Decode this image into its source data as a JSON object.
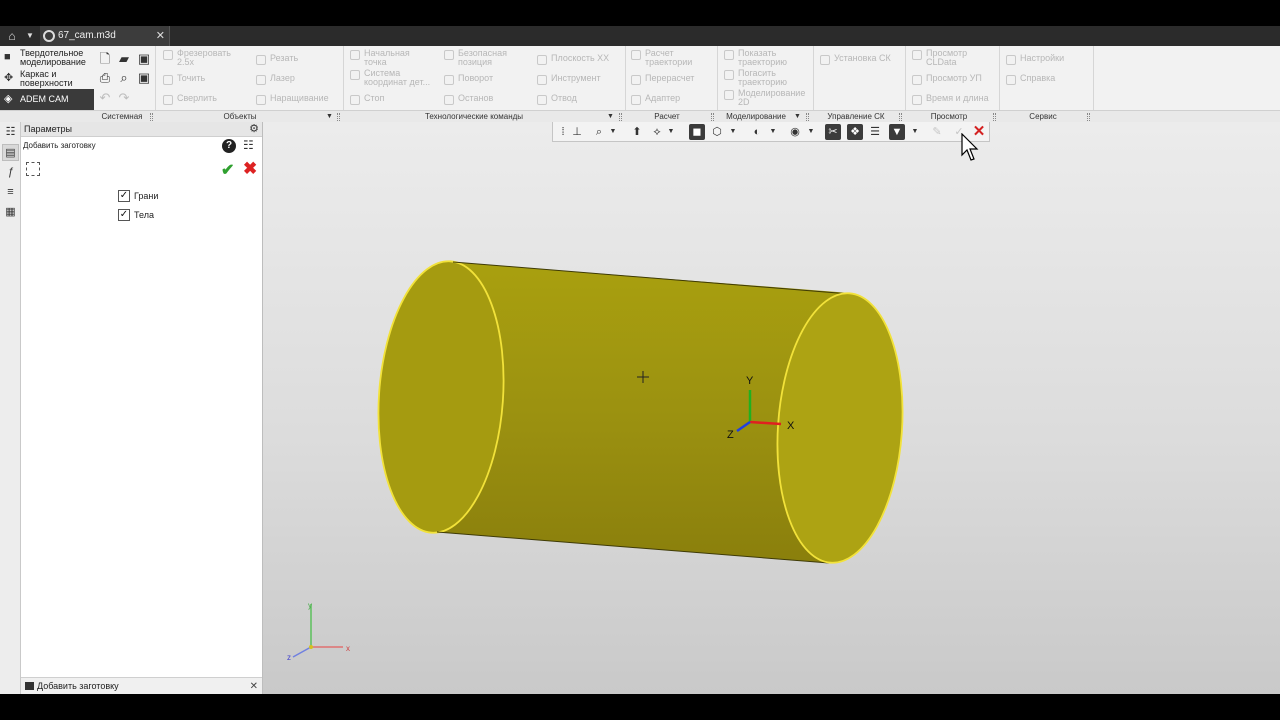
{
  "tabbar": {
    "doc_tab_label": "67_cam.m3d",
    "home_icon": "home-icon",
    "close_glyph": "✕"
  },
  "ribbon": {
    "modes": [
      {
        "label_line1": "Твердотельное",
        "label_line2": "моделирование",
        "icon": "solid-icon"
      },
      {
        "label_line1": "Каркас и",
        "label_line2": "поверхности",
        "icon": "wireframe-icon"
      },
      {
        "label_line1": "ADEM CAM",
        "label_line2": "",
        "icon": "cam-icon",
        "active": true
      }
    ],
    "objects": {
      "mill25_l1": "Фрезеровать",
      "mill25_l2": "2.5x",
      "turn": "Точить",
      "drill": "Сверлить",
      "cut": "Резать",
      "laser": "Лазер",
      "deposit": "Наращивание"
    },
    "tech": {
      "start_point_l1": "Начальная",
      "start_point_l2": "точка",
      "cs_l1": "Система",
      "cs_l2": "координат дет...",
      "stop": "Стоп",
      "safe_l1": "Безопасная",
      "safe_l2": "позиция",
      "rotate": "Поворот",
      "halt": "Останов",
      "plane": "Плоскость XX",
      "tool": "Инструмент",
      "retract": "Отвод"
    },
    "calc": {
      "traj_l1": "Расчет",
      "traj_l2": "траектории",
      "recalc": "Перерасчет",
      "adapter": "Адаптер"
    },
    "modeling": {
      "show_l1": "Показать",
      "show_l2": "траекторию",
      "hide_l1": "Погасить",
      "hide_l2": "траекторию",
      "model2d_l1": "Моделирование",
      "model2d_l2": "2D"
    },
    "csmgmt": {
      "install": "Установка СК"
    },
    "view": {
      "cldata_l1": "Просмотр",
      "cldata_l2": "CLData",
      "up": "Просмотр УП",
      "time": "Время и длина"
    },
    "service": {
      "settings": "Настройки",
      "help": "Справка"
    },
    "group_labels": {
      "system": "Системная",
      "objects": "Объекты",
      "tech": "Технологические команды",
      "calc": "Расчет",
      "modeling": "Моделирование",
      "cs": "Управление СК",
      "view": "Просмотр",
      "service": "Сервис"
    }
  },
  "params": {
    "header": "Параметры",
    "command": "Добавить заготовку",
    "options": [
      {
        "label": "Грани",
        "checked": true
      },
      {
        "label": "Тела",
        "checked": true
      }
    ],
    "footer": "Добавить заготовку",
    "check_glyph": "✓",
    "ok_glyph": "✔",
    "cancel_glyph": "✖",
    "help_glyph": "?"
  },
  "viewport": {
    "axis_labels": {
      "x": "X",
      "y": "Y",
      "z": "Z"
    },
    "triad_labels": {
      "x": "x",
      "y": "y",
      "z": "z"
    },
    "body_color": "#a39a0e",
    "edge_color": "#f2e23a",
    "axis_x_color": "#e02020",
    "axis_y_color": "#20b020",
    "axis_z_color": "#2040e0"
  }
}
